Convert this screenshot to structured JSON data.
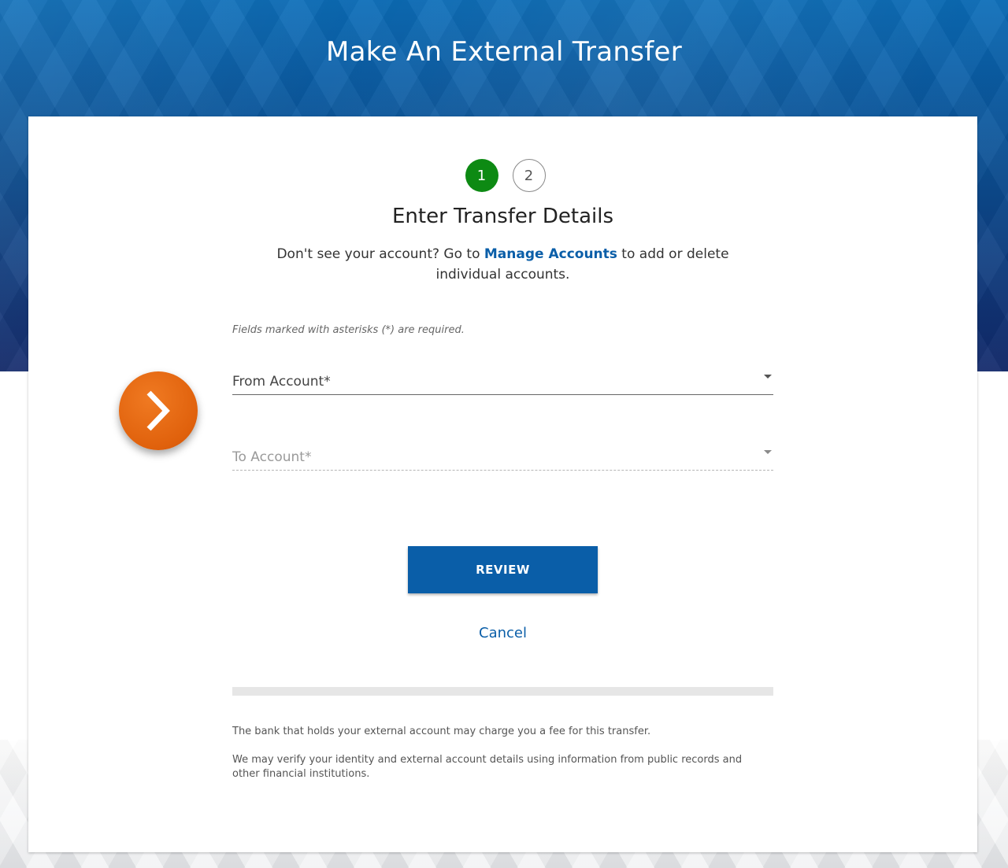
{
  "header": {
    "title": "Make An External Transfer"
  },
  "stepper": {
    "steps": [
      {
        "label": "1",
        "state": "active"
      },
      {
        "label": "2",
        "state": "inactive"
      }
    ],
    "active_color": "#0d8a13"
  },
  "form": {
    "title": "Enter Transfer Details",
    "intro_before": "Don't see your account? Go to ",
    "intro_link": "Manage Accounts",
    "intro_after": " to add or delete individual accounts.",
    "required_note": "Fields marked with asterisks (*) are required.",
    "from_account": {
      "label": "From Account*"
    },
    "to_account": {
      "label": "To Account*",
      "disabled": true
    },
    "review_label": "REVIEW",
    "cancel_label": "Cancel"
  },
  "disclaimers": [
    "The bank that holds your external account may charge you a fee for this transfer.",
    "We may verify your identity and external account details using information from public records and other financial institutions."
  ],
  "nav_badge": {
    "icon": "chevron-right-icon",
    "color": "#e8680f"
  },
  "colors": {
    "link": "#0a5ea8",
    "button": "#0a5ea8",
    "header_top": "#0a6cb8",
    "header_bottom": "#12286a"
  }
}
